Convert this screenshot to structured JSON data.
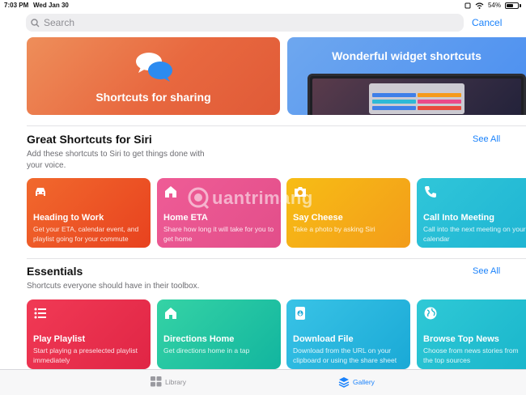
{
  "status": {
    "time": "7:03 PM",
    "date": "Wed Jan 30",
    "battery": "54%"
  },
  "search": {
    "placeholder": "Search",
    "cancel_label": "Cancel"
  },
  "banners": [
    {
      "title": "Shortcuts for sharing",
      "color": "#e8683f"
    },
    {
      "title": "Wonderful widget shortcuts",
      "color": "#4b8ff0"
    }
  ],
  "siri_section": {
    "title": "Great Shortcuts for Siri",
    "subtitle_line1": "Add these shortcuts to Siri to get things done with",
    "subtitle_line2": "your voice.",
    "see_all": "See All",
    "cards": [
      {
        "title": "Heading to Work",
        "desc": "Get your ETA, calendar event, and playlist going for your commute",
        "icon": "car-icon",
        "color_from": "#f1692d",
        "color_to": "#e8421f"
      },
      {
        "title": "Home ETA",
        "desc": "Share how long it will take for you to get home",
        "icon": "home-icon",
        "color_from": "#ef5c96",
        "color_to": "#e24e8a"
      },
      {
        "title": "Say Cheese",
        "desc": "Take a photo by asking Siri",
        "icon": "camera-icon",
        "color_from": "#f7bd15",
        "color_to": "#f39c1a"
      },
      {
        "title": "Call Into Meeting",
        "desc": "Call into the next meeting on your calendar",
        "icon": "phone-icon",
        "color_from": "#30c6d9",
        "color_to": "#1fb5d3"
      }
    ]
  },
  "essentials_section": {
    "title": "Essentials",
    "subtitle": "Shortcuts everyone should have in their toolbox.",
    "see_all": "See All",
    "cards": [
      {
        "title": "Play Playlist",
        "desc": "Start playing a preselected playlist immediately",
        "icon": "list-icon",
        "color_from": "#f13a55",
        "color_to": "#e02545"
      },
      {
        "title": "Directions Home",
        "desc": "Get directions home in a tap",
        "icon": "home-icon",
        "color_from": "#35d3a5",
        "color_to": "#12b59f"
      },
      {
        "title": "Download File",
        "desc": "Download from the URL on your clipboard or using the share sheet",
        "icon": "download-icon",
        "color_from": "#39c3e6",
        "color_to": "#1aa9d6"
      },
      {
        "title": "Browse Top News",
        "desc": "Choose from news stories from the top sources",
        "icon": "globe-icon",
        "color_from": "#2fc9d6",
        "color_to": "#1ab6cc"
      }
    ]
  },
  "watermark": "uantrimang",
  "tabs": {
    "library": "Library",
    "gallery": "Gallery"
  },
  "colors": {
    "accent": "#1a82fb"
  }
}
